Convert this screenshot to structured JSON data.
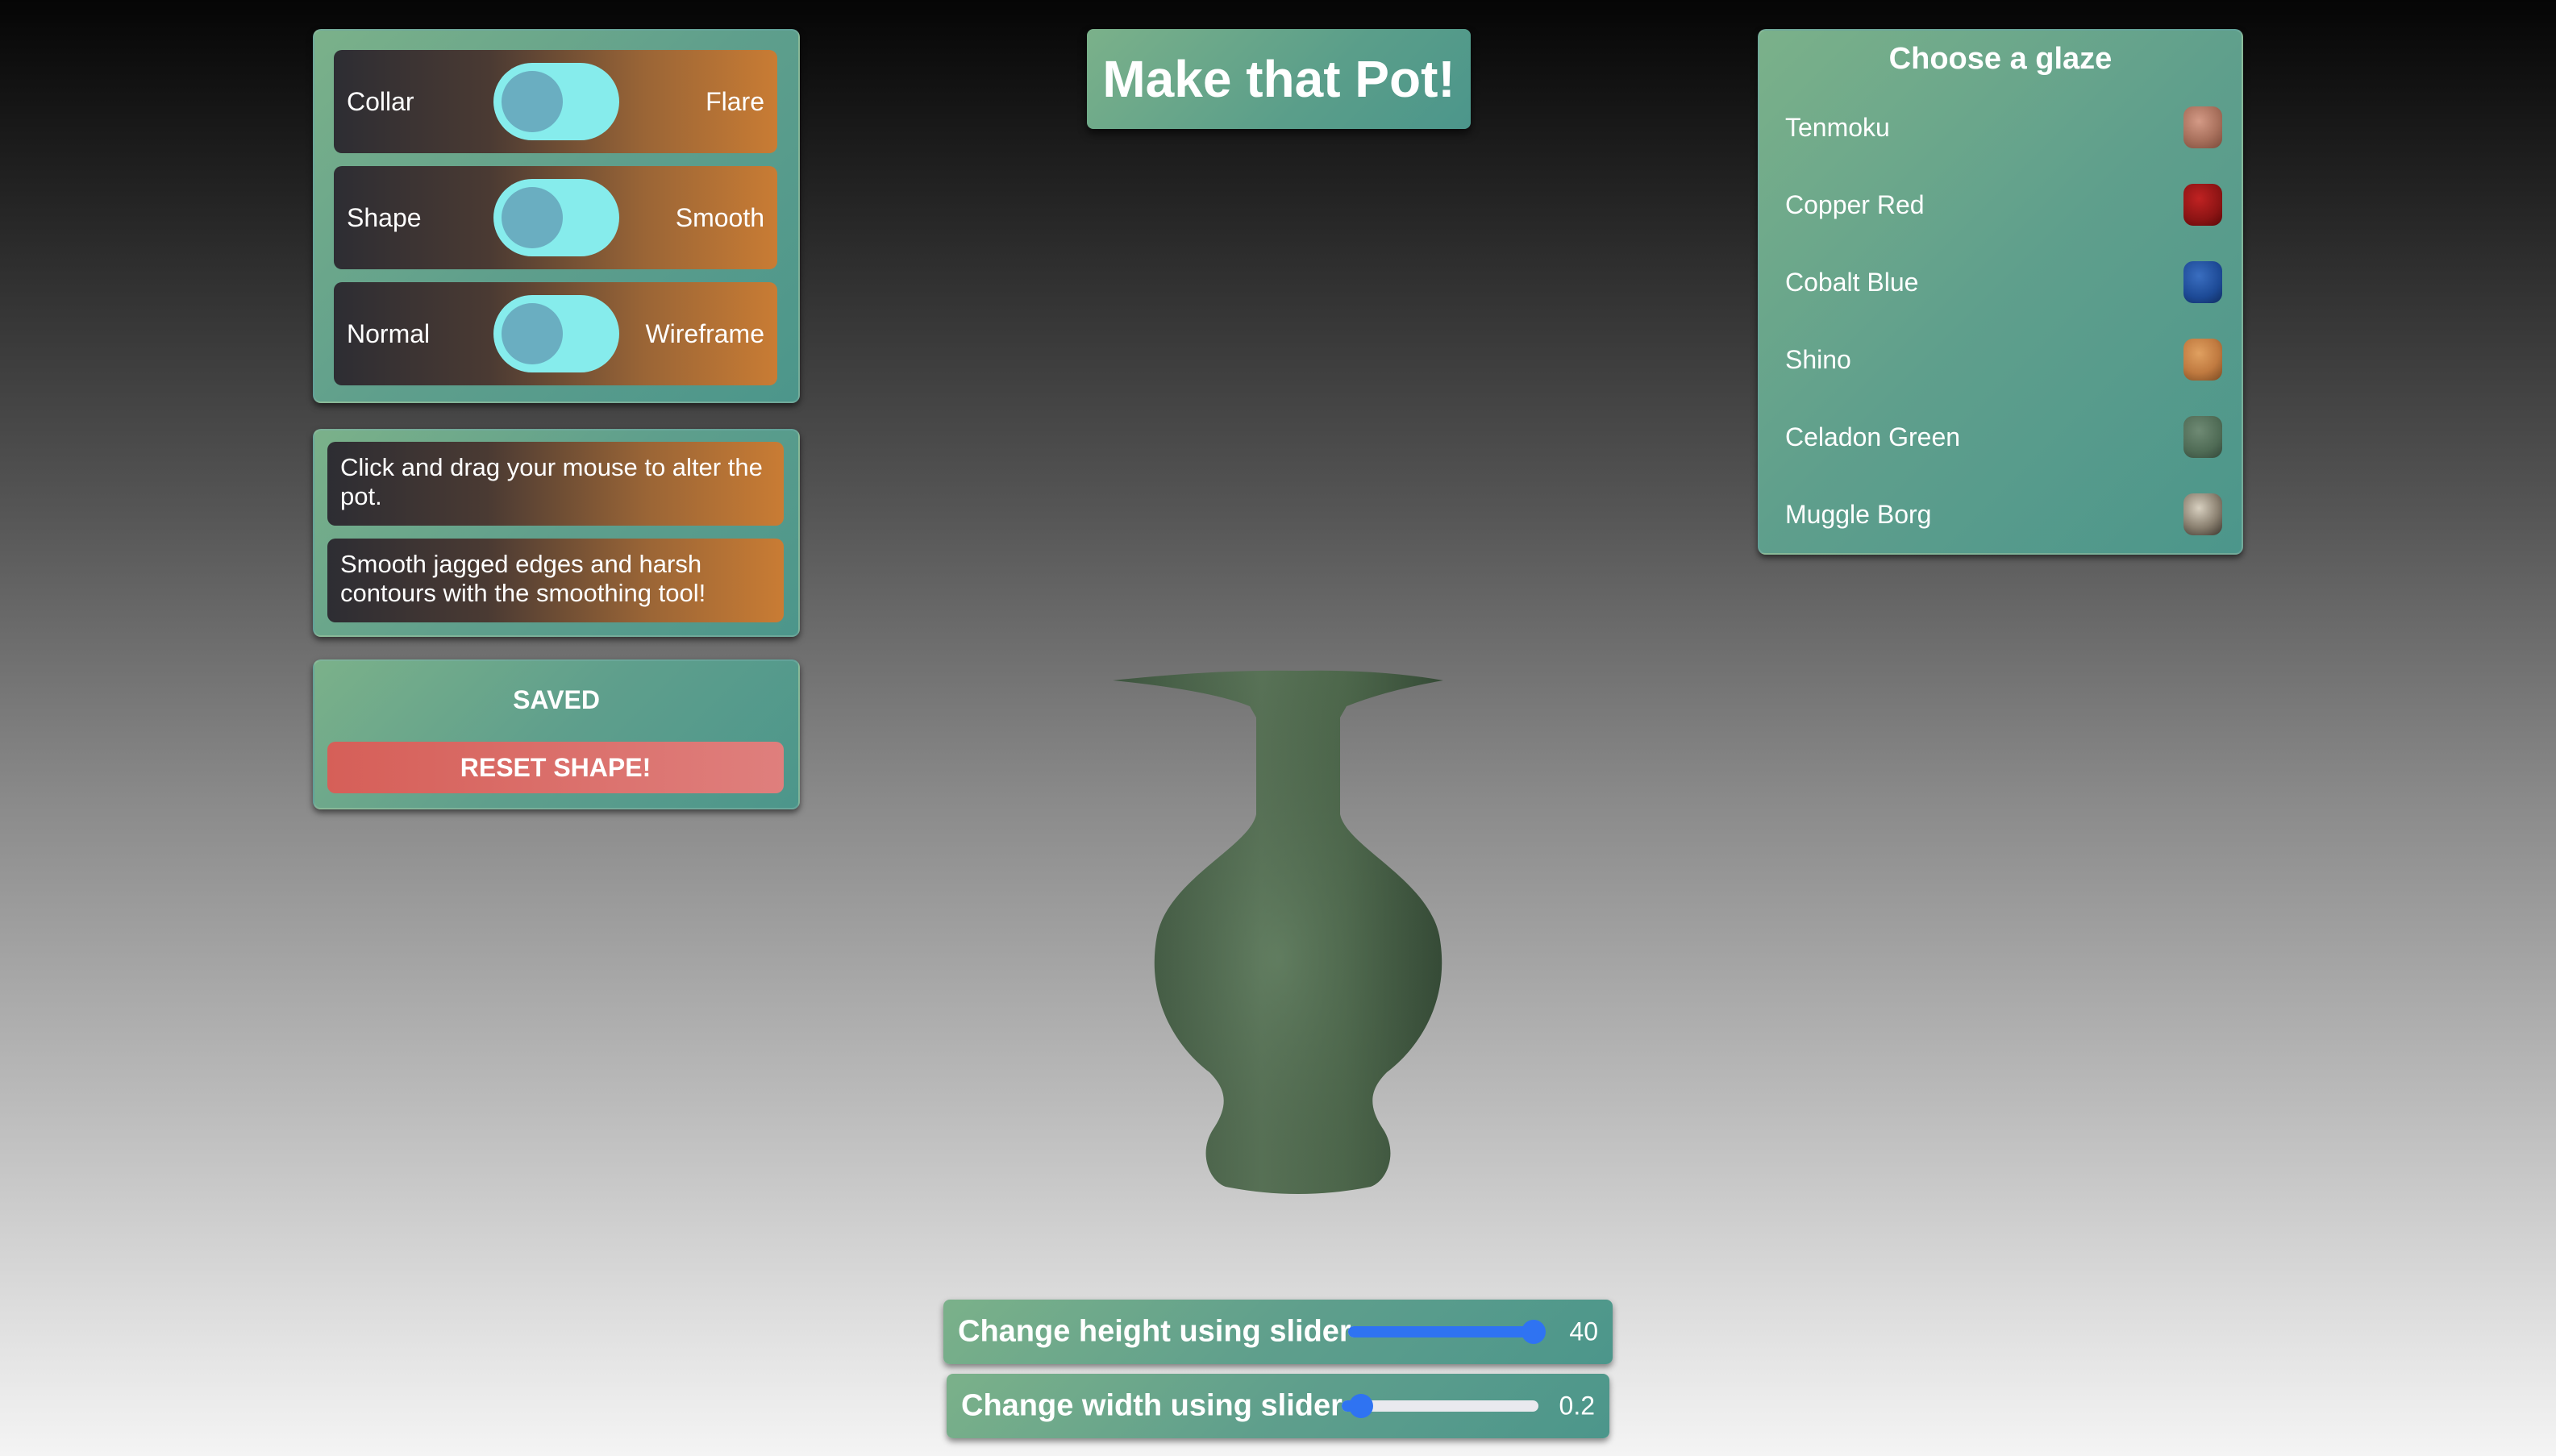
{
  "title": "Make that Pot!",
  "toggles": [
    {
      "left_label": "Collar",
      "right_label": "Flare"
    },
    {
      "left_label": "Shape",
      "right_label": "Smooth"
    },
    {
      "left_label": "Normal",
      "right_label": "Wireframe"
    }
  ],
  "tips": [
    "Click and drag your mouse to alter the pot.",
    "Smooth jagged edges and harsh contours with the smoothing tool!"
  ],
  "save_panel": {
    "status": "SAVED",
    "reset_label": "RESET SHAPE!"
  },
  "glaze": {
    "heading": "Choose a glaze",
    "items": [
      {
        "name": "Tenmoku",
        "color": "#a8705c"
      },
      {
        "name": "Copper Red",
        "color": "#8c1414"
      },
      {
        "name": "Cobalt Blue",
        "color": "#1d4a96"
      },
      {
        "name": "Shino",
        "color": "#c07a40"
      },
      {
        "name": "Celadon Green",
        "color": "#4f6b55"
      },
      {
        "name": "Muggle Borg",
        "color": "#8a8070"
      }
    ]
  },
  "sliders": {
    "height": {
      "label": "Change height using slider",
      "value": "40",
      "fraction": 0.96
    },
    "width": {
      "label": "Change width using slider",
      "value": "0.2",
      "fraction": 0.1
    }
  },
  "colors": {
    "accent_teal": "#5f9f8c",
    "reset_red": "#d9645c",
    "switch_track": "#86ecec",
    "slider_blue": "#2f73f2",
    "pot_green": "#4d6a4d"
  }
}
